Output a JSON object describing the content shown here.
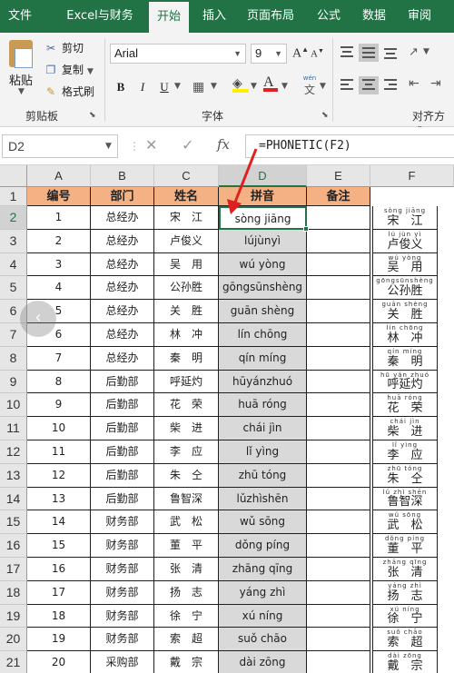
{
  "tabs": [
    {
      "label": "文件",
      "active": false
    },
    {
      "label": "Excel与财务",
      "active": false
    },
    {
      "label": "开始",
      "active": true
    },
    {
      "label": "插入",
      "active": false
    },
    {
      "label": "页面布局",
      "active": false
    },
    {
      "label": "公式",
      "active": false
    },
    {
      "label": "数据",
      "active": false
    },
    {
      "label": "审阅",
      "active": false
    }
  ],
  "ribbon": {
    "clipboard": {
      "paste": "粘贴",
      "cut": "剪切",
      "copy": "复制",
      "format_painter": "格式刷",
      "group_label": "剪贴板"
    },
    "font": {
      "name": "Arial",
      "size": "9",
      "bold": "B",
      "italic": "I",
      "underline": "U",
      "grow": "A",
      "shrink": "A",
      "wen": "wén",
      "wen_char": "文",
      "group_label": "字体"
    },
    "alignment": {
      "group_label": "对齐方式"
    }
  },
  "formula_bar": {
    "name_box": "D2",
    "cancel": "✕",
    "enter": "✓",
    "fx": "fx",
    "formula": "=PHONETIC(F2)"
  },
  "grid": {
    "columns": [
      "A",
      "B",
      "C",
      "D",
      "E",
      "F"
    ],
    "selected_column": "D",
    "header_row": {
      "row": "1",
      "cells": [
        "编号",
        "部门",
        "姓名",
        "拼音",
        "备注",
        ""
      ]
    },
    "rows": [
      {
        "row": "2",
        "id": "1",
        "dept": "总经办",
        "name": "宋　江",
        "pinyin": "sòng jiāng",
        "f_pinyin": "sòng jiāng",
        "f_hanzi": "宋　江"
      },
      {
        "row": "3",
        "id": "2",
        "dept": "总经办",
        "name": "卢俊义",
        "pinyin": "lújùnyì",
        "f_pinyin": "lú jùn yì",
        "f_hanzi": "卢俊义"
      },
      {
        "row": "4",
        "id": "3",
        "dept": "总经办",
        "name": "吴　用",
        "pinyin": "wú yòng",
        "f_pinyin": "wú yòng",
        "f_hanzi": "吴　用"
      },
      {
        "row": "5",
        "id": "4",
        "dept": "总经办",
        "name": "公孙胜",
        "pinyin": "gōngsūnshèng",
        "f_pinyin": "gōngsūnshèng",
        "f_hanzi": "公孙胜"
      },
      {
        "row": "6",
        "id": "5",
        "dept": "总经办",
        "name": "关　胜",
        "pinyin": "guān shèng",
        "f_pinyin": "guān shèng",
        "f_hanzi": "关　胜"
      },
      {
        "row": "7",
        "id": "6",
        "dept": "总经办",
        "name": "林　冲",
        "pinyin": "lín chōng",
        "f_pinyin": "lín chōng",
        "f_hanzi": "林　冲"
      },
      {
        "row": "8",
        "id": "7",
        "dept": "总经办",
        "name": "秦　明",
        "pinyin": "qín míng",
        "f_pinyin": "qín míng",
        "f_hanzi": "秦　明"
      },
      {
        "row": "9",
        "id": "8",
        "dept": "后勤部",
        "name": "呼延灼",
        "pinyin": "hūyánzhuó",
        "f_pinyin": "hū yán zhuó",
        "f_hanzi": "呼延灼"
      },
      {
        "row": "10",
        "id": "9",
        "dept": "后勤部",
        "name": "花　荣",
        "pinyin": "huā róng",
        "f_pinyin": "huā róng",
        "f_hanzi": "花　荣"
      },
      {
        "row": "11",
        "id": "10",
        "dept": "后勤部",
        "name": "柴　进",
        "pinyin": "chái jìn",
        "f_pinyin": "chái jìn",
        "f_hanzi": "柴　进"
      },
      {
        "row": "12",
        "id": "11",
        "dept": "后勤部",
        "name": "李　应",
        "pinyin": "lǐ yìng",
        "f_pinyin": "lǐ yìng",
        "f_hanzi": "李　应"
      },
      {
        "row": "13",
        "id": "12",
        "dept": "后勤部",
        "name": "朱　仝",
        "pinyin": "zhū tóng",
        "f_pinyin": "zhū tóng",
        "f_hanzi": "朱　仝"
      },
      {
        "row": "14",
        "id": "13",
        "dept": "后勤部",
        "name": "鲁智深",
        "pinyin": "lǔzhìshēn",
        "f_pinyin": "lǔ zhì shēn",
        "f_hanzi": "鲁智深"
      },
      {
        "row": "15",
        "id": "14",
        "dept": "财务部",
        "name": "武　松",
        "pinyin": "wǔ sōng",
        "f_pinyin": "wǔ sōng",
        "f_hanzi": "武　松"
      },
      {
        "row": "16",
        "id": "15",
        "dept": "财务部",
        "name": "董　平",
        "pinyin": "dǒng píng",
        "f_pinyin": "dǒng píng",
        "f_hanzi": "董　平"
      },
      {
        "row": "17",
        "id": "16",
        "dept": "财务部",
        "name": "张　清",
        "pinyin": "zhāng qīng",
        "f_pinyin": "zhāng qīng",
        "f_hanzi": "张　清"
      },
      {
        "row": "18",
        "id": "17",
        "dept": "财务部",
        "name": "扬　志",
        "pinyin": "yáng zhì",
        "f_pinyin": "yáng zhì",
        "f_hanzi": "扬　志"
      },
      {
        "row": "19",
        "id": "18",
        "dept": "财务部",
        "name": "徐　宁",
        "pinyin": "xú níng",
        "f_pinyin": "xú níng",
        "f_hanzi": "徐　宁"
      },
      {
        "row": "20",
        "id": "19",
        "dept": "财务部",
        "name": "索　超",
        "pinyin": "suǒ chāo",
        "f_pinyin": "suǒ chāo",
        "f_hanzi": "索　超"
      },
      {
        "row": "21",
        "id": "20",
        "dept": "采购部",
        "name": "戴　宗",
        "pinyin": "dài zōng",
        "f_pinyin": "dài zōng",
        "f_hanzi": "戴　宗"
      }
    ]
  },
  "colors": {
    "excel_green": "#217346",
    "header_fill": "#f4b183",
    "pinyin_fill": "#d9d9d9",
    "arrow": "#e02020"
  },
  "icons": {
    "scroll_left": "chevron-left-icon"
  }
}
